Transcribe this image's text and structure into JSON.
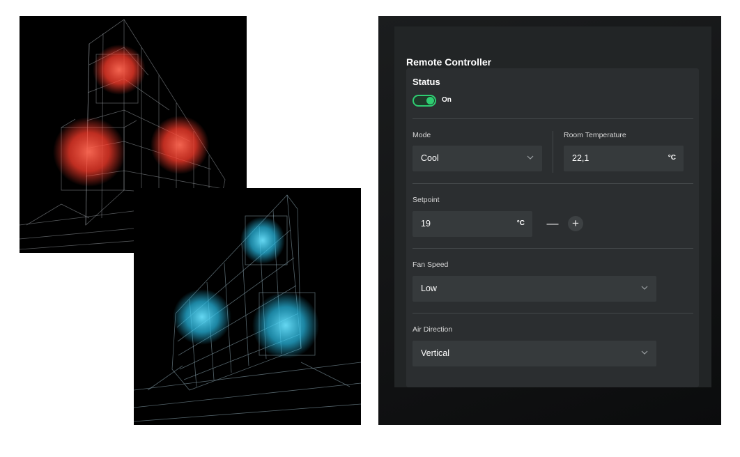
{
  "controller": {
    "title": "Remote Controller",
    "status": {
      "title": "Status",
      "toggle_label": "On",
      "on": true
    },
    "mode": {
      "label": "Mode",
      "value": "Cool",
      "icon": "chevron-down-icon"
    },
    "room_temperature": {
      "label": "Room Temperature",
      "value": "22,1",
      "unit": "°C"
    },
    "setpoint": {
      "label": "Setpoint",
      "value": "19",
      "unit": "°C",
      "decrease_symbol": "—",
      "increase_symbol": "+"
    },
    "fan_speed": {
      "label": "Fan Speed",
      "value": "Low",
      "icon": "chevron-down-icon"
    },
    "air_direction": {
      "label": "Air Direction",
      "value": "Vertical",
      "icon": "chevron-down-icon"
    }
  },
  "colors": {
    "toggle_accent": "#2ecc71",
    "panel_bg": "#222526",
    "card_bg": "#2b2e30",
    "field_bg": "#363a3c",
    "heat_glow": "#ff4b3a",
    "cool_glow": "#31c8ee"
  },
  "images": [
    {
      "name": "building-heating-photo",
      "glow": "red"
    },
    {
      "name": "building-cooling-photo",
      "glow": "cyan"
    }
  ]
}
